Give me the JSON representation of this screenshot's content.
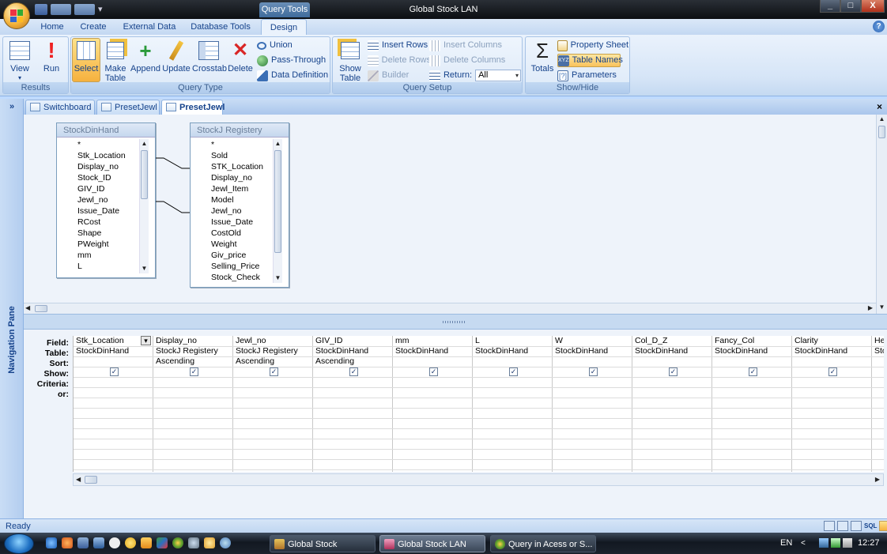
{
  "window": {
    "title": "Global Stock LAN",
    "context_tab": "Query Tools",
    "controls": {
      "minimize": "_",
      "maximize": "□",
      "close": "X"
    },
    "help": "?"
  },
  "ribbon_tabs": [
    "Home",
    "Create",
    "External Data",
    "Database Tools",
    "Design"
  ],
  "ribbon": {
    "results": {
      "label": "Results",
      "view": "View",
      "run": "Run"
    },
    "query_type": {
      "label": "Query Type",
      "select": "Select",
      "make_table_1": "Make",
      "make_table_2": "Table",
      "append": "Append",
      "update": "Update",
      "crosstab": "Crosstab",
      "delete": "Delete",
      "union": "Union",
      "pass_through": "Pass-Through",
      "data_definition": "Data Definition"
    },
    "query_setup": {
      "label": "Query Setup",
      "show_table_1": "Show",
      "show_table_2": "Table",
      "insert_rows": "Insert Rows",
      "delete_rows": "Delete Rows",
      "builder": "Builder",
      "insert_columns": "Insert Columns",
      "delete_columns": "Delete Columns",
      "return_label": "Return:",
      "return_value": "All"
    },
    "show_hide": {
      "label": "Show/Hide",
      "totals": "Totals",
      "property_sheet": "Property Sheet",
      "table_names": "Table Names",
      "parameters": "Parameters"
    }
  },
  "nav_pane": {
    "toggle": "»",
    "label": "Navigation Pane"
  },
  "doc_tabs": [
    "Switchboard",
    "PresetJewl",
    "PresetJewl"
  ],
  "doc_close": "×",
  "tables": [
    {
      "name": "StockDinHand",
      "fields": [
        "*",
        "Stk_Location",
        "Display_no",
        "Stock_ID",
        "GIV_ID",
        "Jewl_no",
        "Issue_Date",
        "RCost",
        "Shape",
        "PWeight",
        "mm",
        "L"
      ]
    },
    {
      "name": "StockJ Registery",
      "fields": [
        "*",
        "Sold",
        "STK_Location",
        "Display_no",
        "Jewl_Item",
        "Model",
        "Jewl_no",
        "Issue_Date",
        "CostOld",
        "Weight",
        "Giv_price",
        "Selling_Price",
        "Stock_Check"
      ]
    }
  ],
  "grid": {
    "row_labels": [
      "Field:",
      "Table:",
      "Sort:",
      "Show:",
      "Criteria:",
      "or:"
    ],
    "columns": [
      {
        "field": "Stk_Location",
        "table": "StockDinHand",
        "sort": "",
        "show": true
      },
      {
        "field": "Display_no",
        "table": "StockJ Registery",
        "sort": "Ascending",
        "show": true
      },
      {
        "field": "Jewl_no",
        "table": "StockJ Registery",
        "sort": "Ascending",
        "show": true
      },
      {
        "field": "GIV_ID",
        "table": "StockDinHand",
        "sort": "Ascending",
        "show": true
      },
      {
        "field": "mm",
        "table": "StockDinHand",
        "sort": "",
        "show": true
      },
      {
        "field": "L",
        "table": "StockDinHand",
        "sort": "",
        "show": true
      },
      {
        "field": "W",
        "table": "StockDinHand",
        "sort": "",
        "show": true
      },
      {
        "field": "Col_D_Z",
        "table": "StockDinHand",
        "sort": "",
        "show": true
      },
      {
        "field": "Fancy_Col",
        "table": "StockDinHand",
        "sort": "",
        "show": true
      },
      {
        "field": "Clarity",
        "table": "StockDinHand",
        "sort": "",
        "show": true
      },
      {
        "field": "He",
        "table": "Sto",
        "sort": "",
        "show": false
      }
    ]
  },
  "status": {
    "text": "Ready",
    "sql": "SQL"
  },
  "taskbar": {
    "buttons": [
      "Global Stock",
      "Global Stock LAN",
      "Query in Acess or S..."
    ],
    "lang": "EN",
    "time": "12:27"
  }
}
